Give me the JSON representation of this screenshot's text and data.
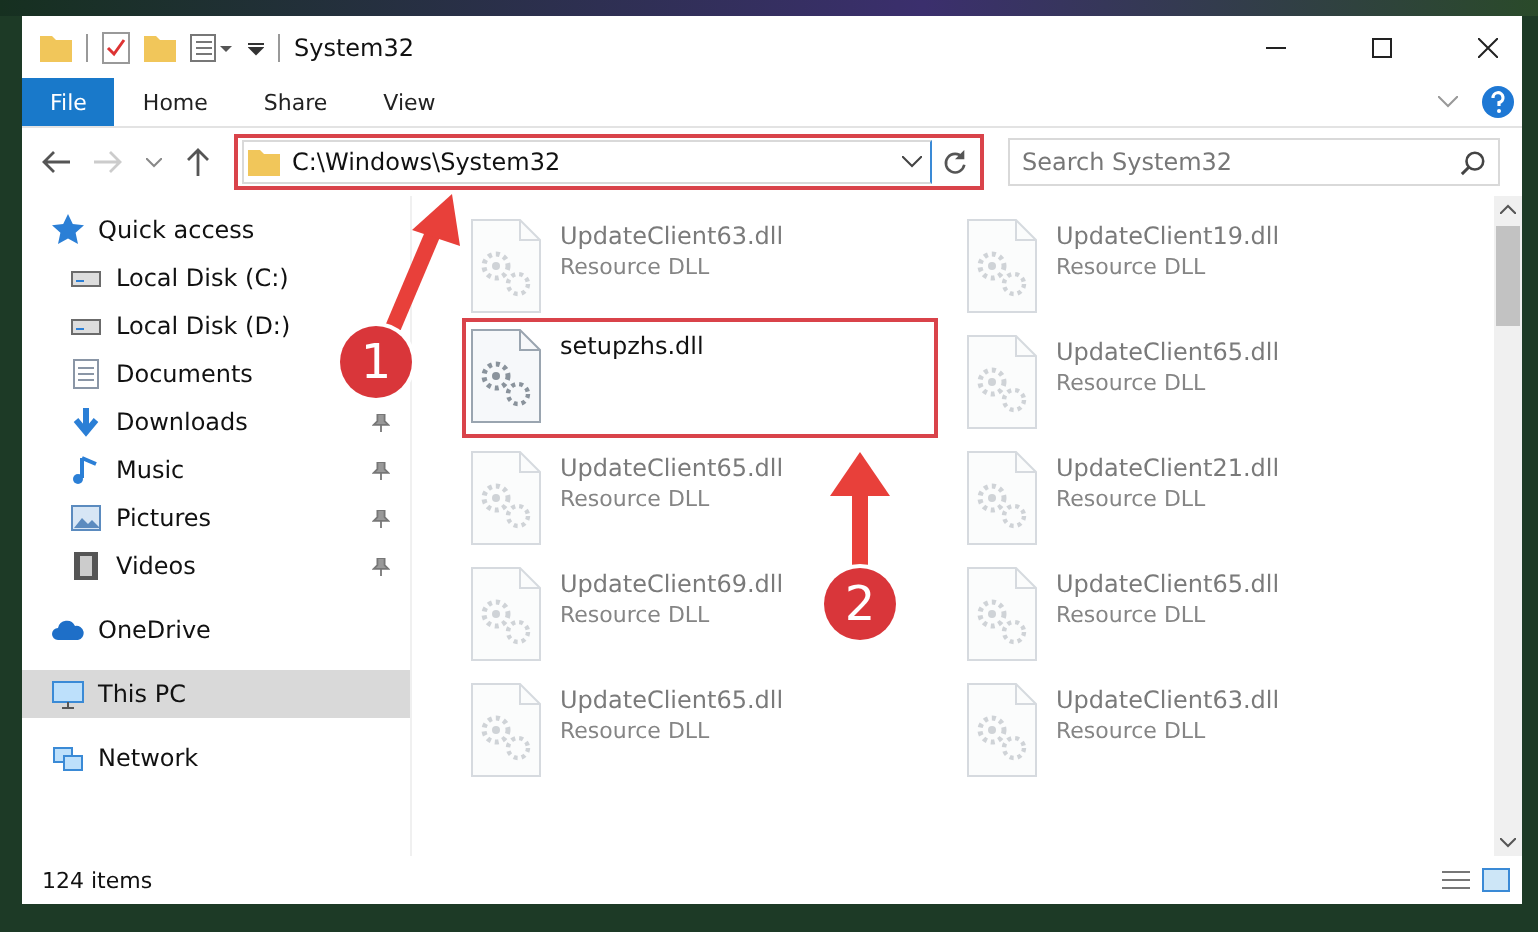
{
  "window": {
    "title": "System32"
  },
  "ribbon": {
    "tabs": [
      {
        "label": "File",
        "selected": true
      },
      {
        "label": "Home",
        "selected": false
      },
      {
        "label": "Share",
        "selected": false
      },
      {
        "label": "View",
        "selected": false
      }
    ]
  },
  "address_bar": {
    "path": "C:\\Windows\\System32",
    "highlighted": true,
    "search_placeholder": "Search System32"
  },
  "sidebar": {
    "items": [
      {
        "label": "Quick access",
        "kind": "star",
        "selected": false,
        "children": [
          {
            "label": "Local Disk (C:)",
            "kind": "disk",
            "pinned": false
          },
          {
            "label": "Local Disk (D:)",
            "kind": "disk",
            "pinned": false
          },
          {
            "label": "Documents",
            "kind": "documents",
            "pinned": false
          },
          {
            "label": "Downloads",
            "kind": "downloads",
            "pinned": true
          },
          {
            "label": "Music",
            "kind": "music",
            "pinned": true
          },
          {
            "label": "Pictures",
            "kind": "pictures",
            "pinned": true
          },
          {
            "label": "Videos",
            "kind": "videos",
            "pinned": true
          }
        ]
      },
      {
        "label": "OneDrive",
        "kind": "cloud",
        "selected": false
      },
      {
        "label": "This PC",
        "kind": "pc",
        "selected": true
      },
      {
        "label": "Network",
        "kind": "network",
        "selected": false
      }
    ]
  },
  "files": [
    {
      "name": "UpdateClient63.dll",
      "type": "Resource DLL",
      "dimmed": true,
      "highlighted": false
    },
    {
      "name": "UpdateClient19.dll",
      "type": "Resource DLL",
      "dimmed": true,
      "highlighted": false
    },
    {
      "name": "setupzhs.dll",
      "dimmed": false,
      "highlighted": true
    },
    {
      "name": "UpdateClient65.dll",
      "type": "Resource DLL",
      "dimmed": true,
      "highlighted": false
    },
    {
      "name": "UpdateClient65.dll",
      "type": "Resource DLL",
      "dimmed": true,
      "highlighted": false
    },
    {
      "name": "UpdateClient21.dll",
      "type": "Resource DLL",
      "dimmed": true,
      "highlighted": false
    },
    {
      "name": "UpdateClient69.dll",
      "type": "Resource DLL",
      "dimmed": true,
      "highlighted": false
    },
    {
      "name": "UpdateClient65.dll",
      "type": "Resource DLL",
      "dimmed": true,
      "highlighted": false
    },
    {
      "name": "UpdateClient65.dll",
      "type": "Resource DLL",
      "dimmed": true,
      "highlighted": false
    },
    {
      "name": "UpdateClient63.dll",
      "type": "Resource DLL",
      "dimmed": true,
      "highlighted": false
    }
  ],
  "annotations": [
    "1",
    "2"
  ],
  "status_bar": {
    "item_count": "124 items"
  }
}
